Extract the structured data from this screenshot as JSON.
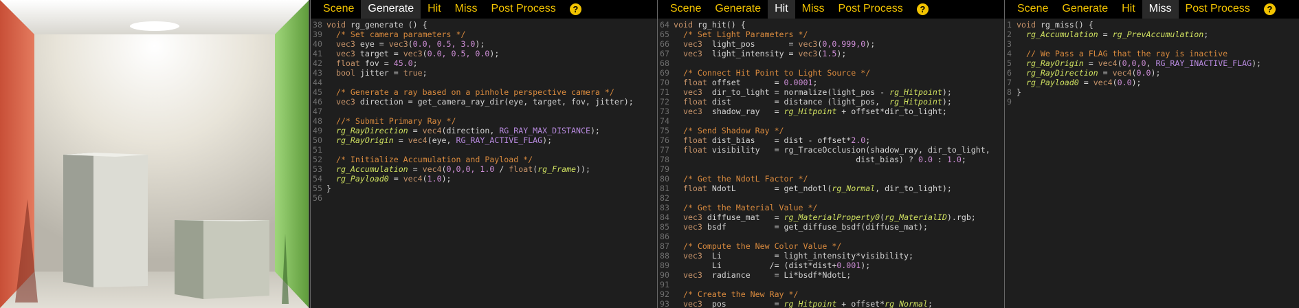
{
  "tabs": {
    "labels": [
      "Scene",
      "Generate",
      "Hit",
      "Miss",
      "Post Process"
    ],
    "help_label": "?"
  },
  "panels": [
    {
      "id": "generate",
      "active_tab": 1,
      "lines": [
        {
          "n": "38",
          "t": [
            [
              "kw",
              "void "
            ],
            [
              "pl",
              "rg_generate () {"
            ]
          ]
        },
        {
          "n": "39",
          "t": [
            [
              "cm",
              "  /* Set camera parameters */"
            ]
          ]
        },
        {
          "n": "40",
          "t": [
            [
              "kw",
              "  vec3 "
            ],
            [
              "pl",
              "eye = "
            ],
            [
              "kw",
              "vec3"
            ],
            [
              "pl",
              "("
            ],
            [
              "num",
              "0.0, 0.5, 3.0"
            ],
            [
              "pl",
              ");"
            ]
          ]
        },
        {
          "n": "41",
          "t": [
            [
              "kw",
              "  vec3 "
            ],
            [
              "pl",
              "target = "
            ],
            [
              "kw",
              "vec3"
            ],
            [
              "pl",
              "("
            ],
            [
              "num",
              "0.0, 0.5, 0.0"
            ],
            [
              "pl",
              ");"
            ]
          ]
        },
        {
          "n": "42",
          "t": [
            [
              "kw",
              "  float "
            ],
            [
              "pl",
              "fov = "
            ],
            [
              "num",
              "45.0"
            ],
            [
              "pl",
              ";"
            ]
          ]
        },
        {
          "n": "43",
          "t": [
            [
              "kw",
              "  bool "
            ],
            [
              "pl",
              "jitter = "
            ],
            [
              "kw",
              "true"
            ],
            [
              "pl",
              ";"
            ]
          ]
        },
        {
          "n": "44",
          "t": []
        },
        {
          "n": "45",
          "t": [
            [
              "cm",
              "  /* Generate a ray based on a pinhole perspective camera */"
            ]
          ]
        },
        {
          "n": "46",
          "t": [
            [
              "kw",
              "  vec3 "
            ],
            [
              "pl",
              "direction = get_camera_ray_dir(eye, target, fov, jitter);"
            ]
          ]
        },
        {
          "n": "47",
          "t": []
        },
        {
          "n": "48",
          "t": [
            [
              "cm",
              "  //* Submit Primary Ray */"
            ]
          ]
        },
        {
          "n": "49",
          "t": [
            [
              "it",
              "  rg_RayDirection"
            ],
            [
              "pl",
              " = "
            ],
            [
              "kw",
              "vec4"
            ],
            [
              "pl",
              "(direction, "
            ],
            [
              "mac",
              "RG_RAY_MAX_DISTANCE"
            ],
            [
              "pl",
              ");"
            ]
          ]
        },
        {
          "n": "50",
          "t": [
            [
              "it",
              "  rg_RayOrigin"
            ],
            [
              "pl",
              " = "
            ],
            [
              "kw",
              "vec4"
            ],
            [
              "pl",
              "(eye, "
            ],
            [
              "mac",
              "RG_RAY_ACTIVE_FLAG"
            ],
            [
              "pl",
              ");"
            ]
          ]
        },
        {
          "n": "51",
          "t": []
        },
        {
          "n": "52",
          "t": [
            [
              "cm",
              "  /* Initialize Accumulation and Payload */"
            ]
          ]
        },
        {
          "n": "53",
          "t": [
            [
              "it",
              "  rg_Accumulation"
            ],
            [
              "pl",
              " = "
            ],
            [
              "kw",
              "vec4"
            ],
            [
              "pl",
              "("
            ],
            [
              "num",
              "0,0,0, 1.0"
            ],
            [
              "pl",
              " / "
            ],
            [
              "kw",
              "float"
            ],
            [
              "pl",
              "("
            ],
            [
              "it",
              "rg_Frame"
            ],
            [
              "pl",
              "));"
            ]
          ]
        },
        {
          "n": "54",
          "t": [
            [
              "it",
              "  rg_Payload0"
            ],
            [
              "pl",
              " = "
            ],
            [
              "kw",
              "vec4"
            ],
            [
              "pl",
              "("
            ],
            [
              "num",
              "1.0"
            ],
            [
              "pl",
              ");"
            ]
          ]
        },
        {
          "n": "55",
          "t": [
            [
              "pl",
              "}"
            ]
          ]
        },
        {
          "n": "56",
          "t": []
        }
      ]
    },
    {
      "id": "hit",
      "active_tab": 2,
      "lines": [
        {
          "n": "64",
          "t": [
            [
              "kw",
              "void "
            ],
            [
              "pl",
              "rg_hit() {"
            ]
          ]
        },
        {
          "n": "65",
          "t": [
            [
              "cm",
              "  /* Set Light Parameters */"
            ]
          ]
        },
        {
          "n": "66",
          "t": [
            [
              "kw",
              "  vec3  "
            ],
            [
              "pl",
              "light_pos       = "
            ],
            [
              "kw",
              "vec3"
            ],
            [
              "pl",
              "("
            ],
            [
              "num",
              "0,0.999,0"
            ],
            [
              "pl",
              ");"
            ]
          ]
        },
        {
          "n": "67",
          "t": [
            [
              "kw",
              "  vec3  "
            ],
            [
              "pl",
              "light_intensity = "
            ],
            [
              "kw",
              "vec3"
            ],
            [
              "pl",
              "("
            ],
            [
              "num",
              "1.5"
            ],
            [
              "pl",
              ");"
            ]
          ]
        },
        {
          "n": "68",
          "t": []
        },
        {
          "n": "69",
          "t": [
            [
              "cm",
              "  /* Connect Hit Point to Light Source */"
            ]
          ]
        },
        {
          "n": "70",
          "t": [
            [
              "kw",
              "  float "
            ],
            [
              "pl",
              "offset       = "
            ],
            [
              "num",
              "0.0001"
            ],
            [
              "pl",
              ";"
            ]
          ]
        },
        {
          "n": "71",
          "t": [
            [
              "kw",
              "  vec3  "
            ],
            [
              "pl",
              "dir_to_light = normalize(light_pos - "
            ],
            [
              "it",
              "rg_Hitpoint"
            ],
            [
              "pl",
              ");"
            ]
          ]
        },
        {
          "n": "72",
          "t": [
            [
              "kw",
              "  float "
            ],
            [
              "pl",
              "dist         = distance (light_pos,  "
            ],
            [
              "it",
              "rg_Hitpoint"
            ],
            [
              "pl",
              ");"
            ]
          ]
        },
        {
          "n": "73",
          "t": [
            [
              "kw",
              "  vec3  "
            ],
            [
              "pl",
              "shadow_ray   = "
            ],
            [
              "it",
              "rg_Hitpoint"
            ],
            [
              "pl",
              " + offset*dir_to_light;"
            ]
          ]
        },
        {
          "n": "74",
          "t": []
        },
        {
          "n": "75",
          "t": [
            [
              "cm",
              "  /* Send Shadow Ray */"
            ]
          ]
        },
        {
          "n": "76",
          "t": [
            [
              "kw",
              "  float "
            ],
            [
              "pl",
              "dist_bias    = dist - offset*"
            ],
            [
              "num",
              "2.0"
            ],
            [
              "pl",
              ";"
            ]
          ]
        },
        {
          "n": "77",
          "t": [
            [
              "kw",
              "  float "
            ],
            [
              "pl",
              "visibility   = rg_TraceOcclusion(shadow_ray, dir_to_light,"
            ]
          ]
        },
        {
          "n": "78",
          "t": [
            [
              "pl",
              "                                      dist_bias) ? "
            ],
            [
              "num",
              "0.0"
            ],
            [
              "pl",
              " : "
            ],
            [
              "num",
              "1.0"
            ],
            [
              "pl",
              ";"
            ]
          ]
        },
        {
          "n": "79",
          "t": []
        },
        {
          "n": "80",
          "t": [
            [
              "cm",
              "  /* Get the NdotL Factor */"
            ]
          ]
        },
        {
          "n": "81",
          "t": [
            [
              "kw",
              "  float "
            ],
            [
              "pl",
              "NdotL        = get_ndotl("
            ],
            [
              "it",
              "rg_Normal"
            ],
            [
              "pl",
              ", dir_to_light);"
            ]
          ]
        },
        {
          "n": "82",
          "t": []
        },
        {
          "n": "83",
          "t": [
            [
              "cm",
              "  /* Get the Material Value */"
            ]
          ]
        },
        {
          "n": "84",
          "t": [
            [
              "kw",
              "  vec3 "
            ],
            [
              "pl",
              "diffuse_mat   = "
            ],
            [
              "it",
              "rg_MaterialProperty0"
            ],
            [
              "pl",
              "("
            ],
            [
              "it",
              "rg_MaterialID"
            ],
            [
              "pl",
              ").rgb;"
            ]
          ]
        },
        {
          "n": "85",
          "t": [
            [
              "kw",
              "  vec3 "
            ],
            [
              "pl",
              "bsdf          = get_diffuse_bsdf(diffuse_mat);"
            ]
          ]
        },
        {
          "n": "86",
          "t": []
        },
        {
          "n": "87",
          "t": [
            [
              "cm",
              "  /* Compute the New Color Value */"
            ]
          ]
        },
        {
          "n": "88",
          "t": [
            [
              "kw",
              "  vec3  "
            ],
            [
              "pl",
              "Li           = light_intensity*visibility;"
            ]
          ]
        },
        {
          "n": "89",
          "t": [
            [
              "pl",
              "        Li          /= (dist*dist+"
            ],
            [
              "num",
              "0.001"
            ],
            [
              "pl",
              ");"
            ]
          ]
        },
        {
          "n": "90",
          "t": [
            [
              "kw",
              "  vec3  "
            ],
            [
              "pl",
              "radiance     = Li*bsdf*NdotL;"
            ]
          ]
        },
        {
          "n": "91",
          "t": []
        },
        {
          "n": "92",
          "t": [
            [
              "cm",
              "  /* Create the New Ray */"
            ]
          ]
        },
        {
          "n": "93",
          "t": [
            [
              "kw",
              "  vec3  "
            ],
            [
              "pl",
              "pos          = "
            ],
            [
              "it",
              "rg_Hitpoint"
            ],
            [
              "pl",
              " + offset*"
            ],
            [
              "it",
              "rg_Normal"
            ],
            [
              "pl",
              ";"
            ]
          ]
        }
      ]
    },
    {
      "id": "miss",
      "active_tab": 3,
      "lines": [
        {
          "n": "1",
          "t": [
            [
              "kw",
              "void "
            ],
            [
              "pl",
              "rg_miss() {"
            ]
          ]
        },
        {
          "n": "2",
          "t": [
            [
              "it",
              "  rg_Accumulation"
            ],
            [
              "pl",
              " = "
            ],
            [
              "it",
              "rg_PrevAccumulation"
            ],
            [
              "pl",
              ";"
            ]
          ]
        },
        {
          "n": "3",
          "t": []
        },
        {
          "n": "4",
          "t": [
            [
              "cm",
              "  // We Pass a FLAG that the ray is inactive"
            ]
          ]
        },
        {
          "n": "5",
          "t": [
            [
              "it",
              "  rg_RayOrigin"
            ],
            [
              "pl",
              " = "
            ],
            [
              "kw",
              "vec4"
            ],
            [
              "pl",
              "("
            ],
            [
              "num",
              "0,0,0"
            ],
            [
              "pl",
              ", "
            ],
            [
              "mac",
              "RG_RAY_INACTIVE_FLAG"
            ],
            [
              "pl",
              ");"
            ]
          ]
        },
        {
          "n": "6",
          "t": [
            [
              "it",
              "  rg_RayDirection"
            ],
            [
              "pl",
              " = "
            ],
            [
              "kw",
              "vec4"
            ],
            [
              "pl",
              "("
            ],
            [
              "num",
              "0.0"
            ],
            [
              "pl",
              ");"
            ]
          ]
        },
        {
          "n": "7",
          "t": [
            [
              "it",
              "  rg_Payload0"
            ],
            [
              "pl",
              " = "
            ],
            [
              "kw",
              "vec4"
            ],
            [
              "pl",
              "("
            ],
            [
              "num",
              "0.0"
            ],
            [
              "pl",
              ");"
            ]
          ]
        },
        {
          "n": "8",
          "t": [
            [
              "pl",
              "}"
            ]
          ]
        },
        {
          "n": "9",
          "t": []
        }
      ]
    }
  ]
}
